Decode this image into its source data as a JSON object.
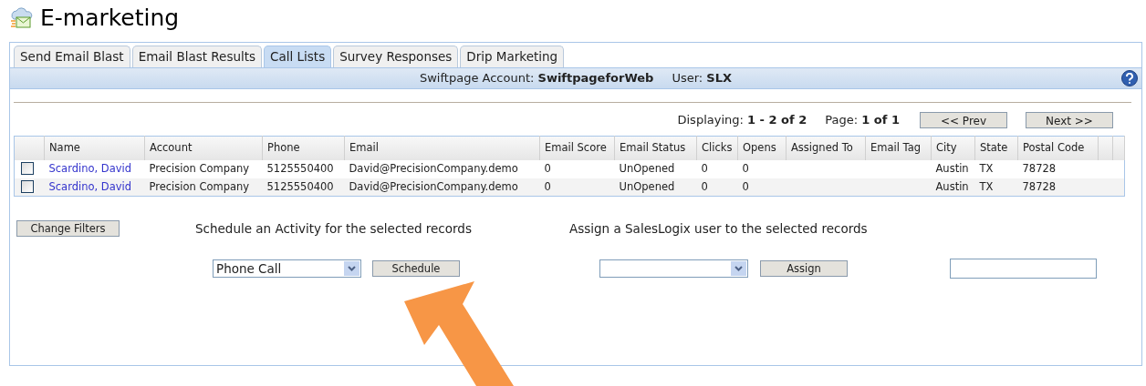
{
  "title": "E-marketing",
  "tabs": [
    {
      "label": "Send Email Blast",
      "selected": false
    },
    {
      "label": "Email Blast Results",
      "selected": false
    },
    {
      "label": "Call Lists",
      "selected": true
    },
    {
      "label": "Survey Responses",
      "selected": false
    },
    {
      "label": "Drip Marketing",
      "selected": false
    }
  ],
  "account_bar": {
    "account_label": "Swiftpage Account:",
    "account": "SwiftpageforWeb",
    "user_label": "User:",
    "user": "SLX"
  },
  "paging": {
    "displaying_label": "Displaying:",
    "displaying": "1 - 2 of 2",
    "page_label": "Page:",
    "page": "1 of 1",
    "prev": "<< Prev",
    "next": "Next >>"
  },
  "table": {
    "columns": [
      "Name",
      "Account",
      "Phone",
      "Email",
      "Email Score",
      "Email Status",
      "Clicks",
      "Opens",
      "Assigned To",
      "Email Tag",
      "City",
      "State",
      "Postal Code"
    ],
    "rows": [
      {
        "checked": false,
        "cells": [
          "Scardino, David",
          "Precision Company",
          "5125550400",
          "David@PrecisionCompany.demo",
          "0",
          "UnOpened",
          "0",
          "0",
          "",
          "",
          "Austin",
          "TX",
          "78728"
        ]
      },
      {
        "checked": false,
        "cells": [
          "Scardino, David",
          "Precision Company",
          "5125550400",
          "David@PrecisionCompany.demo",
          "0",
          "UnOpened",
          "0",
          "0",
          "",
          "",
          "Austin",
          "TX",
          "78728"
        ]
      }
    ]
  },
  "change_filters": "Change Filters",
  "schedule": {
    "heading": "Schedule an Activity for the selected records",
    "activity": "Phone Call",
    "button": "Schedule"
  },
  "assign": {
    "heading": "Assign a SalesLogix user to the selected records",
    "button": "Assign"
  }
}
